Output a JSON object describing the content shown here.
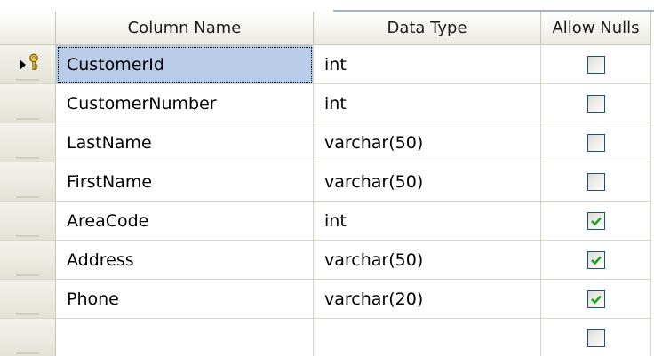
{
  "header": {
    "column_name": "Column Name",
    "data_type": "Data Type",
    "allow_nulls": "Allow Nulls"
  },
  "rows": [
    {
      "name": "CustomerId",
      "type": "int",
      "allow_nulls": false,
      "primary_key": true,
      "selected": true
    },
    {
      "name": "CustomerNumber",
      "type": "int",
      "allow_nulls": false
    },
    {
      "name": "LastName",
      "type": "varchar(50)",
      "allow_nulls": false
    },
    {
      "name": "FirstName",
      "type": "varchar(50)",
      "allow_nulls": false
    },
    {
      "name": "AreaCode",
      "type": "int",
      "allow_nulls": true
    },
    {
      "name": "Address",
      "type": "varchar(50)",
      "allow_nulls": true
    },
    {
      "name": "Phone",
      "type": "varchar(20)",
      "allow_nulls": true
    },
    {
      "name": "",
      "type": "",
      "allow_nulls": false
    }
  ],
  "icons": {
    "row_indicator": "arrow-icon",
    "primary_key": "key-icon",
    "checkmark": "checkmark-icon"
  },
  "colors": {
    "selection": "#b8cce8",
    "checkmark": "#21a121",
    "checkbox_border": "#1c5180"
  }
}
